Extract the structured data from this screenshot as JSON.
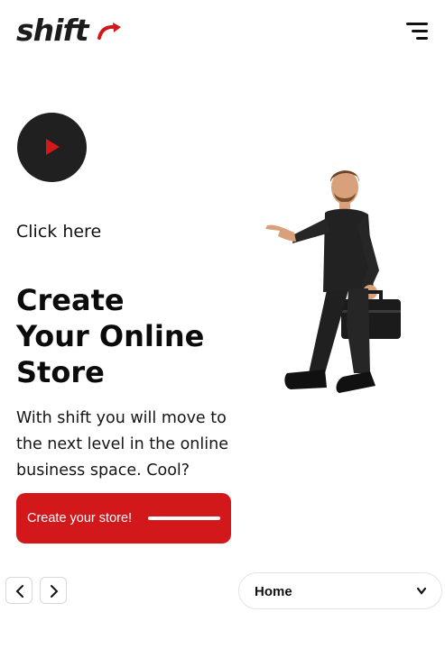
{
  "header": {
    "logo_text": "shift",
    "menu_icon": "hamburger-menu-icon"
  },
  "hero": {
    "play_icon": "play-icon",
    "click_label": "Click here",
    "title_lines": [
      "Create",
      "Your Online",
      "Store"
    ],
    "description": "With shift you will move to the next level in the online business space. Cool?",
    "cta_label": "Create your store!",
    "illustration": "businessman-with-briefcase"
  },
  "pager": {
    "prev_icon": "chevron-left-icon",
    "next_icon": "chevron-right-icon"
  },
  "nav_select": {
    "value": "Home",
    "icon": "chevron-down-icon"
  },
  "colors": {
    "accent": "#d3181b",
    "dark": "#202020",
    "text": "#111111"
  }
}
